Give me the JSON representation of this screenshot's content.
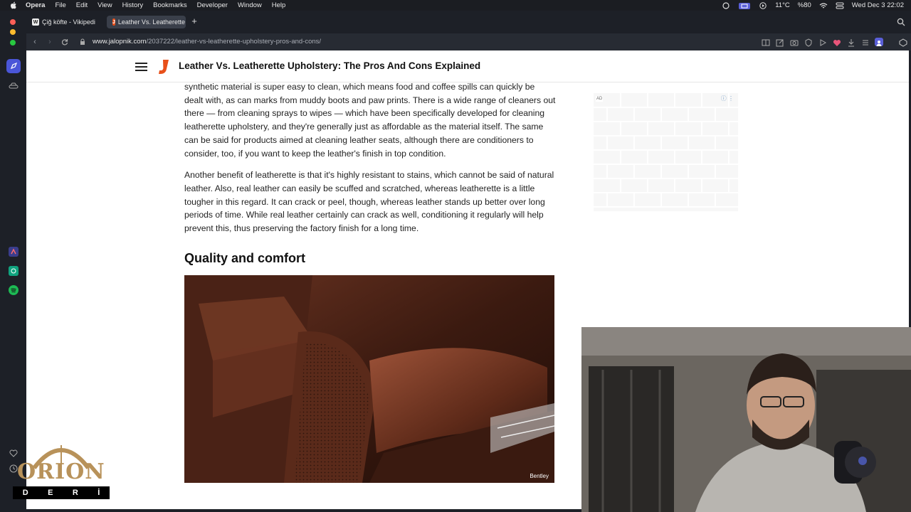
{
  "menubar": {
    "app_name": "Opera",
    "items": [
      "File",
      "Edit",
      "View",
      "History",
      "Bookmarks",
      "Developer",
      "Window",
      "Help"
    ],
    "temperature": "11°C",
    "battery": "%80",
    "datetime": "Wed Dec 3  22:02"
  },
  "tabs": [
    {
      "label": "Çiğ köfte - Vikipedi",
      "favicon": "W",
      "active": false
    },
    {
      "label": "Leather Vs. Leatherette",
      "favicon": "J",
      "active": true
    }
  ],
  "address": {
    "url_host": "www.jalopnik.com",
    "url_path": "/2037222/leather-vs-leatherette-upholstery-pros-and-cons/"
  },
  "site": {
    "title": "Leather Vs. Leatherette Upholstery: The Pros And Cons Explained",
    "brand_color": "#e8501a"
  },
  "article": {
    "paragraph_1": "synthetic material is super easy to clean, which means food and coffee spills can quickly be dealt with, as can marks from muddy boots and paw prints. There is a wide range of cleaners out there — from cleaning sprays to wipes — which have been specifically developed for cleaning leatherette upholstery, and they're generally just as affordable as the material itself. The same can be said for products aimed at cleaning leather seats, although there are conditioners to consider, too, if you want to keep the leather's finish in top condition.",
    "paragraph_2": "Another benefit of leatherette is that it's highly resistant to stains, which cannot be said of natural leather. Also, real leather can easily be scuffed and scratched, whereas leatherette is a little tougher in this regard. It can crack or peel, though, whereas leather stands up better over long periods of time. While real leather certainly can crack as well, conditioning it regularly will help prevent this, thus preserving the factory finish for a long time.",
    "section_heading": "Quality and comfort",
    "photo_credit": "Bentley"
  },
  "ad": {
    "label": "AD",
    "info_icon": "ⓘ ⋮"
  },
  "watermark": {
    "name": "ORION",
    "letters": [
      "D",
      "E",
      "R",
      "İ"
    ]
  }
}
